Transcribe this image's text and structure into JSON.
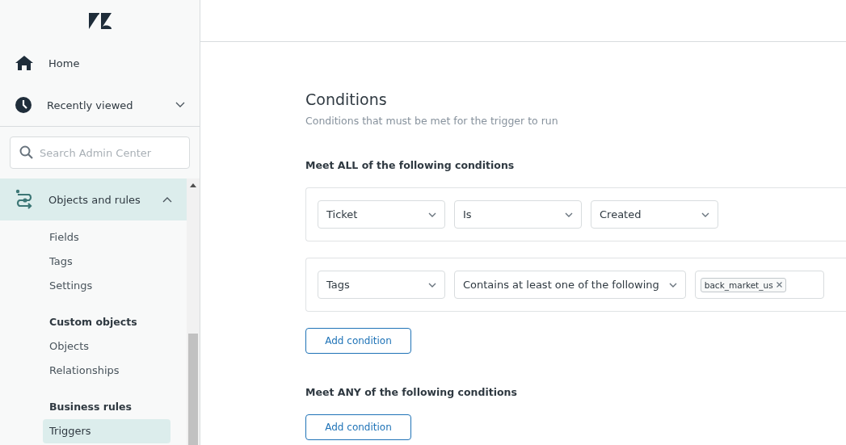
{
  "nav": [
    {
      "kind": "home",
      "label": "Home"
    },
    {
      "kind": "recent",
      "label": "Recently viewed",
      "expanded": false
    }
  ],
  "search": {
    "placeholder": "Search Admin Center"
  },
  "category": {
    "label": "Objects and rules",
    "selected": true,
    "expanded": true
  },
  "menu": [
    {
      "items": [
        {
          "label": "Fields",
          "selected": false
        },
        {
          "label": "Tags",
          "selected": false
        },
        {
          "label": "Settings",
          "selected": false
        }
      ]
    },
    {
      "heading": "Custom objects",
      "items": [
        {
          "label": "Objects",
          "selected": false
        },
        {
          "label": "Relationships",
          "selected": false
        }
      ]
    },
    {
      "heading": "Business rules",
      "items": [
        {
          "label": "Triggers",
          "selected": true
        }
      ]
    }
  ],
  "section": {
    "title": "Conditions",
    "subtitle": "Conditions that must be met for the trigger to run"
  },
  "groups": [
    {
      "heading": "Meet ALL of the following conditions",
      "button": "Add condition",
      "conditions": [
        {
          "fields": [
            {
              "kind": "select",
              "value": "Ticket"
            },
            {
              "kind": "select",
              "value": "Is"
            },
            {
              "kind": "select",
              "value": "Created"
            }
          ]
        },
        {
          "fields": [
            {
              "kind": "select",
              "value": "Tags"
            },
            {
              "kind": "select",
              "value": "Contains at least one of the following"
            },
            {
              "kind": "tags",
              "tags": [
                "back_market_us"
              ]
            }
          ]
        }
      ]
    },
    {
      "heading": "Meet ANY of the following conditions",
      "button": "Add condition"
    }
  ]
}
